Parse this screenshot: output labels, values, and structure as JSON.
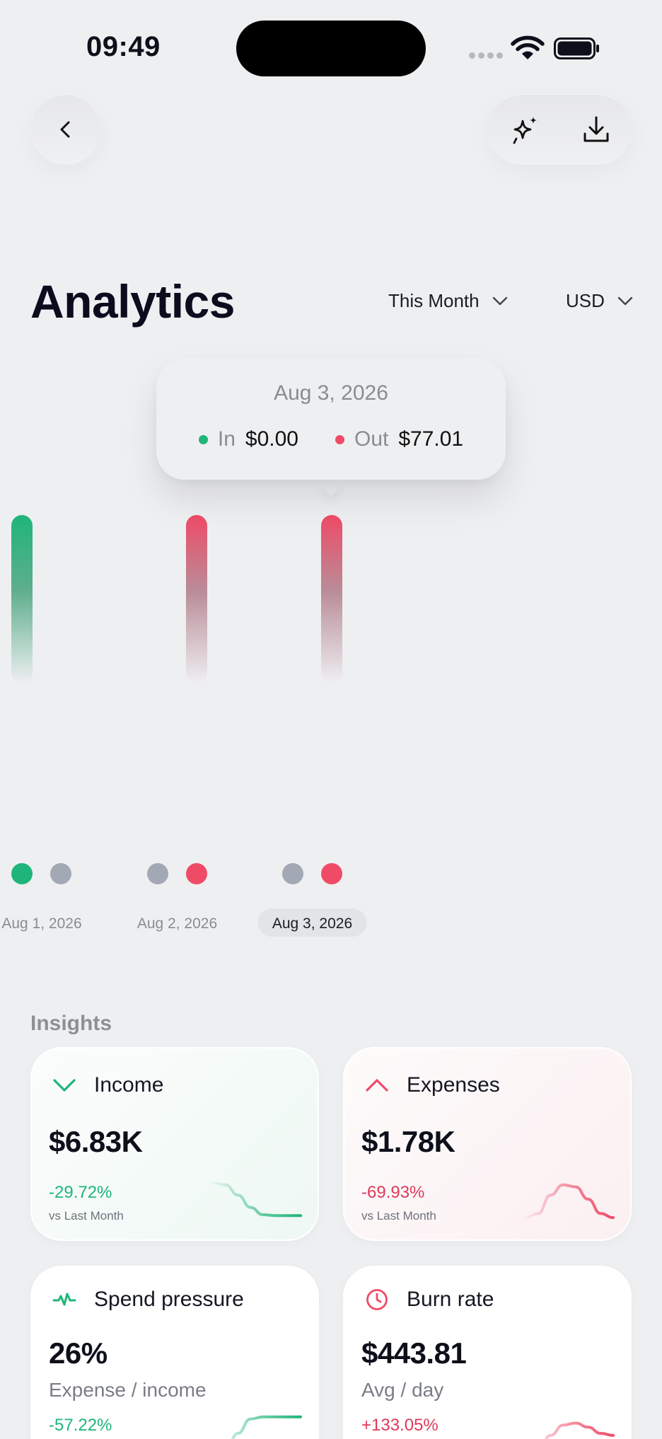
{
  "status_bar": {
    "time": "09:49"
  },
  "header": {
    "title": "Analytics",
    "period": "This Month",
    "currency": "USD"
  },
  "tooltip": {
    "date": "Aug 3, 2026",
    "in_label": "In",
    "in_value": "$0.00",
    "out_label": "Out",
    "out_value": "$77.01"
  },
  "colors": {
    "income": "#1fb57a",
    "expense": "#ef4b67",
    "neutral_dot": "#a3a9b4"
  },
  "chart_data": {
    "type": "bar",
    "categories": [
      "Aug 1, 2026",
      "Aug 2, 2026",
      "Aug 3, 2026"
    ],
    "series": [
      {
        "name": "In",
        "values": [
          1,
          0,
          0
        ]
      },
      {
        "name": "Out",
        "values": [
          0,
          1,
          1
        ]
      }
    ],
    "selected_category": "Aug 3, 2026",
    "selected_values": {
      "In": "$0.00",
      "Out": "$77.01"
    }
  },
  "insights": {
    "heading": "Insights",
    "income": {
      "title": "Income",
      "value": "$6.83K",
      "change": "-29.72%",
      "compare": "vs Last Month",
      "trend": [
        0.9,
        0.85,
        0.6,
        0.3,
        0.12,
        0.1,
        0.1,
        0.1
      ]
    },
    "expenses": {
      "title": "Expenses",
      "value": "$1.78K",
      "change": "-69.93%",
      "compare": "vs Last Month",
      "trend": [
        0.05,
        0.15,
        0.6,
        0.85,
        0.8,
        0.5,
        0.15,
        0.05
      ]
    },
    "spend_pressure": {
      "title": "Spend pressure",
      "value": "26%",
      "subtitle": "Expense / income",
      "change": "-57.22%",
      "icon": "pulse-icon",
      "trend": [
        0.0,
        0.1,
        0.5,
        0.85,
        0.9,
        0.9,
        0.9,
        0.9
      ]
    },
    "burn_rate": {
      "title": "Burn rate",
      "value": "$443.81",
      "subtitle": "Avg / day",
      "change": "+133.05%",
      "icon": "clock-icon",
      "trend": [
        0.0,
        0.1,
        0.45,
        0.7,
        0.75,
        0.65,
        0.5,
        0.45
      ]
    }
  }
}
